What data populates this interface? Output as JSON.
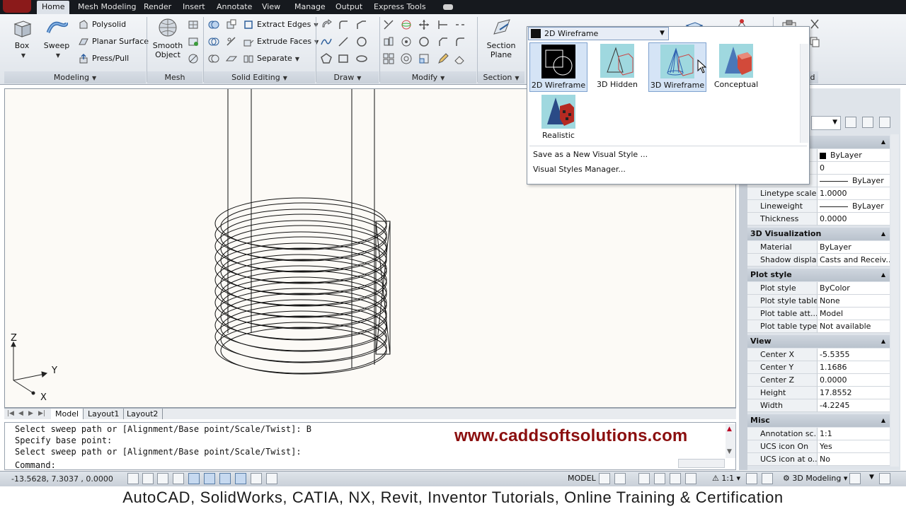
{
  "ribbon_tabs": [
    "Home",
    "Mesh Modeling",
    "Render",
    "Insert",
    "Annotate",
    "View",
    "Manage",
    "Output",
    "Express Tools"
  ],
  "ribbon": {
    "box": "Box",
    "sweep": "Sweep",
    "polysolid": "Polysolid",
    "planar_surface": "Planar Surface",
    "press_pull": "Press/Pull",
    "smooth_object_1": "Smooth",
    "smooth_object_2": "Object",
    "extract_edges": "Extract Edges",
    "extrude_faces": "Extrude Faces",
    "separate": "Separate",
    "section_plane_1": "Section",
    "section_plane_2": "Plane",
    "panels": {
      "modeling": "Modeling",
      "mesh": "Mesh",
      "solid_editing": "Solid Editing",
      "draw": "Draw",
      "modify": "Modify",
      "section": "Section",
      "clipped": "d"
    }
  },
  "visual_styles": {
    "current": "2D Wireframe",
    "tiles": [
      {
        "label": "2D Wireframe"
      },
      {
        "label": "3D Hidden"
      },
      {
        "label": "3D Wireframe"
      },
      {
        "label": "Conceptual"
      },
      {
        "label": "Realistic"
      }
    ],
    "menu": [
      "Save as a New Visual Style ...",
      "Visual Styles Manager..."
    ]
  },
  "ucs": {
    "x": "X",
    "y": "Y",
    "z": "Z"
  },
  "layout_tabs": [
    "Model",
    "Layout1",
    "Layout2"
  ],
  "command_lines": [
    "Select sweep path or [Alignment/Base point/Scale/Twist]: B",
    "Specify base point:",
    "Select sweep path or [Alignment/Base point/Scale/Twist]:",
    "Command:"
  ],
  "watermark": "www.caddsoftsolutions.com",
  "status": {
    "coords": "-13.5628, 7.3037 , 0.0000",
    "model": "MODEL",
    "scale": "1:1",
    "workspace": "3D Modeling"
  },
  "caption": "AutoCAD, SolidWorks, CATIA, NX, Revit, Inventor Tutorials, Online Training & Certification",
  "properties": {
    "general_rows": [
      {
        "k": "",
        "v": "ByLayer",
        "swatch": true
      },
      {
        "k": "",
        "v": "0"
      },
      {
        "k": "",
        "v": "ByLayer",
        "line": true
      },
      {
        "k": "Linetype scale",
        "v": "1.0000"
      },
      {
        "k": "Lineweight",
        "v": "ByLayer",
        "line": true
      },
      {
        "k": "Thickness",
        "v": "0.0000"
      }
    ],
    "viz_title": "3D Visualization",
    "viz_rows": [
      {
        "k": "Material",
        "v": "ByLayer"
      },
      {
        "k": "Shadow display",
        "v": "Casts and Receiv..."
      }
    ],
    "plot_title": "Plot style",
    "plot_rows": [
      {
        "k": "Plot style",
        "v": "ByColor"
      },
      {
        "k": "Plot style table",
        "v": "None"
      },
      {
        "k": "Plot table att...",
        "v": "Model"
      },
      {
        "k": "Plot table type",
        "v": "Not available"
      }
    ],
    "view_title": "View",
    "view_rows": [
      {
        "k": "Center X",
        "v": "-5.5355"
      },
      {
        "k": "Center Y",
        "v": "1.1686"
      },
      {
        "k": "Center Z",
        "v": "0.0000"
      },
      {
        "k": "Height",
        "v": "17.8552"
      },
      {
        "k": "Width",
        "v": "-4.2245"
      }
    ],
    "misc_title": "Misc",
    "misc_rows": [
      {
        "k": "Annotation sc...",
        "v": "1:1"
      },
      {
        "k": "UCS icon On",
        "v": "Yes"
      },
      {
        "k": "UCS icon at o...",
        "v": "No"
      }
    ]
  },
  "colors": {
    "accent": "#7fa2cf",
    "watermark": "#8b0f0f",
    "tabbar": "#16191e"
  }
}
